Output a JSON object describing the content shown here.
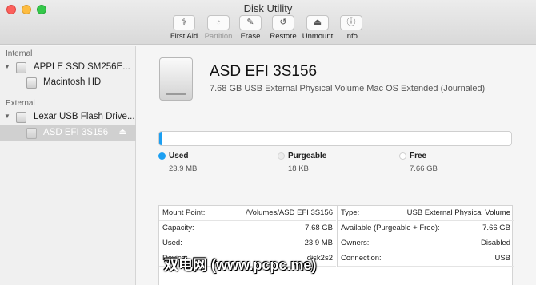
{
  "window": {
    "title": "Disk Utility"
  },
  "toolbar": [
    {
      "label": "First Aid",
      "icon": "stethoscope-icon",
      "glyph": "⚕",
      "enabled": true
    },
    {
      "label": "Partition",
      "icon": "partition-icon",
      "glyph": "◔",
      "enabled": false
    },
    {
      "label": "Erase",
      "icon": "erase-icon",
      "glyph": "✎",
      "enabled": true
    },
    {
      "label": "Restore",
      "icon": "restore-icon",
      "glyph": "↺",
      "enabled": true
    },
    {
      "label": "Unmount",
      "icon": "unmount-icon",
      "glyph": "⏏",
      "enabled": true
    },
    {
      "label": "Info",
      "icon": "info-icon",
      "glyph": "ⓘ",
      "enabled": true
    }
  ],
  "sidebar": {
    "internal_header": "Internal",
    "external_header": "External",
    "internal_disk": "APPLE SSD SM256E...",
    "internal_volume": "Macintosh HD",
    "external_disk": "Lexar USB Flash Drive...",
    "external_volume": "ASD EFI 3S156"
  },
  "volume": {
    "name": "ASD EFI 3S156",
    "description": "7.68 GB USB External Physical Volume Mac OS Extended (Journaled)",
    "used_fraction": 0.003
  },
  "legend": [
    {
      "name": "Used",
      "value": "23.9 MB",
      "color": "#1b9ff2"
    },
    {
      "name": "Purgeable",
      "value": "18 KB",
      "color": "#e8e8e8"
    },
    {
      "name": "Free",
      "value": "7.66 GB",
      "color": "#ffffff"
    }
  ],
  "info_left": [
    {
      "key": "Mount Point:",
      "value": "/Volumes/ASD EFI 3S156"
    },
    {
      "key": "Capacity:",
      "value": "7.68 GB"
    },
    {
      "key": "Used:",
      "value": "23.9 MB"
    },
    {
      "key": "Device:",
      "value": "disk2s2"
    }
  ],
  "info_right": [
    {
      "key": "Type:",
      "value": "USB External Physical Volume"
    },
    {
      "key": "Available (Purgeable + Free):",
      "value": "7.66 GB"
    },
    {
      "key": "Owners:",
      "value": "Disabled"
    },
    {
      "key": "Connection:",
      "value": "USB"
    }
  ],
  "watermark": "双电网 (www.pcpc.me)"
}
